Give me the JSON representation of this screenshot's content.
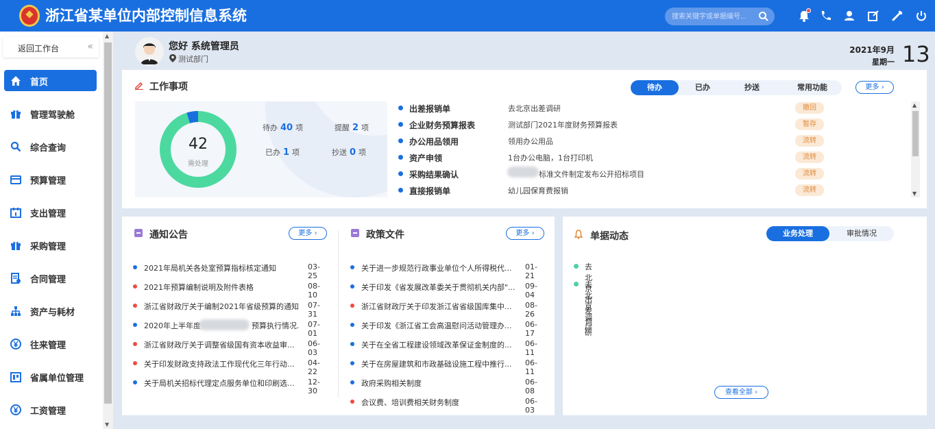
{
  "app": {
    "title": "浙江省某单位内部控制信息系统"
  },
  "search": {
    "placeholder": "搜索关键字或单据编号..."
  },
  "sidebar": {
    "back_label": "返回工作台",
    "items": [
      {
        "label": "首页",
        "icon": "home-icon"
      },
      {
        "label": "管理驾驶舱",
        "icon": "gift-icon"
      },
      {
        "label": "综合查询",
        "icon": "search-icon"
      },
      {
        "label": "预算管理",
        "icon": "card-icon"
      },
      {
        "label": "支出管理",
        "icon": "calendar-icon"
      },
      {
        "label": "采购管理",
        "icon": "gift-icon"
      },
      {
        "label": "合同管理",
        "icon": "contract-icon"
      },
      {
        "label": "资产与耗材",
        "icon": "org-icon"
      },
      {
        "label": "往来管理",
        "icon": "yen-icon"
      },
      {
        "label": "省属单位管理",
        "icon": "building-icon"
      },
      {
        "label": "工资管理",
        "icon": "yen-icon"
      }
    ]
  },
  "user": {
    "greeting": "您好 系统管理员",
    "department": "测试部门"
  },
  "date": {
    "year_month": "2021年9月",
    "weekday": "星期一",
    "day": "13"
  },
  "work": {
    "title": "工作事项",
    "tabs": [
      "待办",
      "已办",
      "抄送",
      "常用功能"
    ],
    "more_label": "更多 ›",
    "total": "42",
    "total_label": "需处理",
    "pending_fraction": 0.952,
    "stats": {
      "pending_label": "待办",
      "pending": "40",
      "pending_unit": "项",
      "remind_label": "提醒",
      "remind": "2",
      "remind_unit": "项",
      "done_label": "已办",
      "done": "1",
      "done_unit": "项",
      "cc_label": "抄送",
      "cc": "0",
      "cc_unit": "项"
    },
    "rows": [
      {
        "name": "出差报销单",
        "desc": "去北京出差调研",
        "status": "撤回"
      },
      {
        "name": "企业财务预算报表",
        "desc": "测试部门2021年度财务预算报表",
        "status": "暂存"
      },
      {
        "name": "办公用品领用",
        "desc": "领用办公用品",
        "status": "流转"
      },
      {
        "name": "资产申领",
        "desc": "1台办公电脑，1台打印机",
        "status": "流转"
      },
      {
        "name": "采购结果确认",
        "desc": "标准文件制定发布公开招标项目",
        "status": "流转"
      },
      {
        "name": "直接报销单",
        "desc": "幼儿园保育费报销",
        "status": "流转"
      }
    ]
  },
  "notices": {
    "title": "通知公告",
    "more_label": "更多 ›",
    "items": [
      {
        "text": "2021年局机关各处室预算指标核定通知",
        "date": "03-25",
        "color": "#1a6fe0"
      },
      {
        "text": "2021年预算编制说明及附件表格",
        "date": "08-10",
        "color": "#f04a3f"
      },
      {
        "text": "浙江省财政厅关于编制2021年省级预算的通知",
        "date": "07-31",
        "color": "#f04a3f"
      },
      {
        "text": "2020年上半年度",
        "text_tail": "预算执行情况...",
        "date": "07-01",
        "color": "#1a6fe0"
      },
      {
        "text": "浙江省财政厅关于调整省级国有资本收益审...",
        "date": "06-03",
        "color": "#f04a3f"
      },
      {
        "text": "关于印发财政支持政法工作现代化三年行动...",
        "date": "04-22",
        "color": "#f04a3f"
      },
      {
        "text": "关于局机关招标代理定点服务单位和印刷选...",
        "date": "12-30",
        "color": "#1a6fe0"
      }
    ]
  },
  "policies": {
    "title": "政策文件",
    "more_label": "更多 ›",
    "items": [
      {
        "text": "关于进一步规范行政事业单位个人所得税代...",
        "date": "01-21",
        "color": "#1a6fe0"
      },
      {
        "text": "关于印发《省发展改革委关于贯彻机关内部\"...",
        "date": "09-04",
        "color": "#1a6fe0"
      },
      {
        "text": "浙江省财政厅关于印发浙江省省级国库集中...",
        "date": "08-26",
        "color": "#f04a3f"
      },
      {
        "text": "关于印发《浙江省工会高温慰问活动管理办...",
        "date": "06-17",
        "color": "#1a6fe0"
      },
      {
        "text": "关于在全省工程建设领域改革保证金制度的...",
        "date": "06-11",
        "color": "#1a6fe0"
      },
      {
        "text": "关于在房屋建筑和市政基础设施工程中推行...",
        "date": "06-11",
        "color": "#1a6fe0"
      },
      {
        "text": "政府采购相关制度",
        "date": "06-08",
        "color": "#1a6fe0"
      },
      {
        "text": "会议费、培训费相关财务制度",
        "date": "06-03",
        "color": "#f04a3f"
      }
    ]
  },
  "dynamics": {
    "title": "单据动态",
    "tabs": [
      "业务处理",
      "审批情况"
    ],
    "items": [
      "去北京出差调研",
      "去北京调研"
    ],
    "view_all_label": "查看全部 ›"
  },
  "colors": {
    "primary": "#1a6fe0",
    "donut": "#4cd9a0",
    "badge_bg": "#fbe9d6",
    "badge_text": "#e08a3a"
  }
}
